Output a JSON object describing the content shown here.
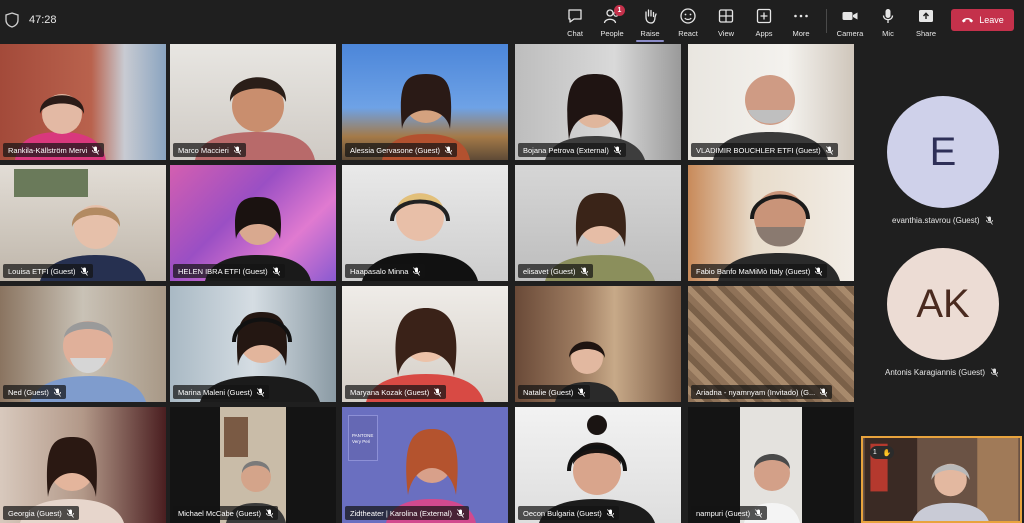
{
  "meeting": {
    "timer": "47:28"
  },
  "toolbar": {
    "items": [
      {
        "label": "Chat",
        "icon": "chat-icon"
      },
      {
        "label": "People",
        "icon": "people-icon",
        "badge": "1"
      },
      {
        "label": "Raise",
        "icon": "raise-hand-icon",
        "active": true
      },
      {
        "label": "React",
        "icon": "react-icon"
      },
      {
        "label": "View",
        "icon": "view-icon"
      },
      {
        "label": "Apps",
        "icon": "apps-icon"
      },
      {
        "label": "More",
        "icon": "more-icon"
      },
      {
        "label": "Camera",
        "icon": "camera-icon"
      },
      {
        "label": "Mic",
        "icon": "mic-icon"
      },
      {
        "label": "Share",
        "icon": "share-icon"
      }
    ],
    "leave_label": "Leave"
  },
  "participants": [
    {
      "name": "Rankila-Källström Mervi"
    },
    {
      "name": "Marco Maccieri"
    },
    {
      "name": "Alessia Gervasone (Guest)",
      "speaking": true
    },
    {
      "name": "Bojana Petrova (External)"
    },
    {
      "name": "VLADIMIR BOUCHLER ETFI (Guest)"
    },
    {
      "name": "Louisa ETFI (Guest)"
    },
    {
      "name": "HELEN IBRA ETFI (Guest)"
    },
    {
      "name": "Haapasalo Minna"
    },
    {
      "name": "elisavet (Guest)"
    },
    {
      "name": "Fabio Banfo MaMiMò Italy (Guest)"
    },
    {
      "name": "Ned (Guest)"
    },
    {
      "name": "Marina Maleni (Guest)"
    },
    {
      "name": "Maryana Kozak (Guest)"
    },
    {
      "name": "Natalie (Guest)"
    },
    {
      "name": "Ariadna - nyamnyam (Invitado) (G..."
    },
    {
      "name": "Georgia (Guest)"
    },
    {
      "name": "Michael McCabe (Guest)"
    },
    {
      "name": "Zidtheater | Karolina (External)"
    },
    {
      "name": "Oecon Bulgaria (Guest)"
    },
    {
      "name": "nampuri (Guest)"
    }
  ],
  "side_participants": [
    {
      "initials": "E",
      "name": "evanthia.stavrou (Guest)",
      "bg": "#cfd1ea",
      "fg": "#2e2f57"
    },
    {
      "initials": "AK",
      "name": "Antonis Karagiannis (Guest)",
      "bg": "#ecdcd4",
      "fg": "#4a2a1f"
    }
  ],
  "self_view": {
    "raised_hand_count": "1"
  },
  "pantone_card": {
    "line1": "PANTONE",
    "line2": "Very Peri"
  }
}
